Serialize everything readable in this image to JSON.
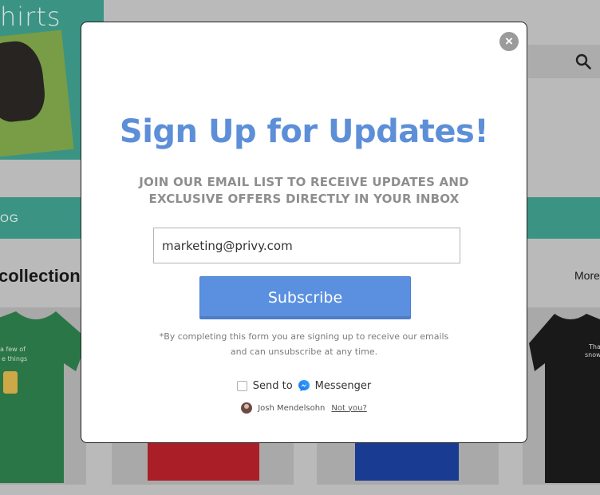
{
  "background": {
    "logo_text": "hirts",
    "nav_label": "OG",
    "collection_heading": "collection",
    "more_link": "More",
    "shirt_left_text_1": "a few of",
    "shirt_left_text_2": "e things",
    "shirt_right_text_1": "Tha",
    "shirt_right_text_2": "snow"
  },
  "modal": {
    "close_label": "×",
    "title": "Sign Up for Updates!",
    "subtitle_line1": "JOIN OUR EMAIL LIST TO RECEIVE UPDATES AND",
    "subtitle_line2": "EXCLUSIVE OFFERS DIRECTLY IN YOUR INBOX",
    "email_value": "marketing@privy.com",
    "subscribe_label": "Subscribe",
    "disclaimer_line1": "*By completing this form you are signing up to receive our emails",
    "disclaimer_line2": "and can unsubscribe at any time.",
    "messenger": {
      "send_to_label": "Send to",
      "messenger_label": "Messenger",
      "checked": false
    },
    "user": {
      "name": "Josh Mendelsohn",
      "not_you_label": "Not you?"
    }
  },
  "colors": {
    "title": "#5d8fd8",
    "subscribe_button": "#5b90e0",
    "teal_brand": "#3f9b8c"
  }
}
